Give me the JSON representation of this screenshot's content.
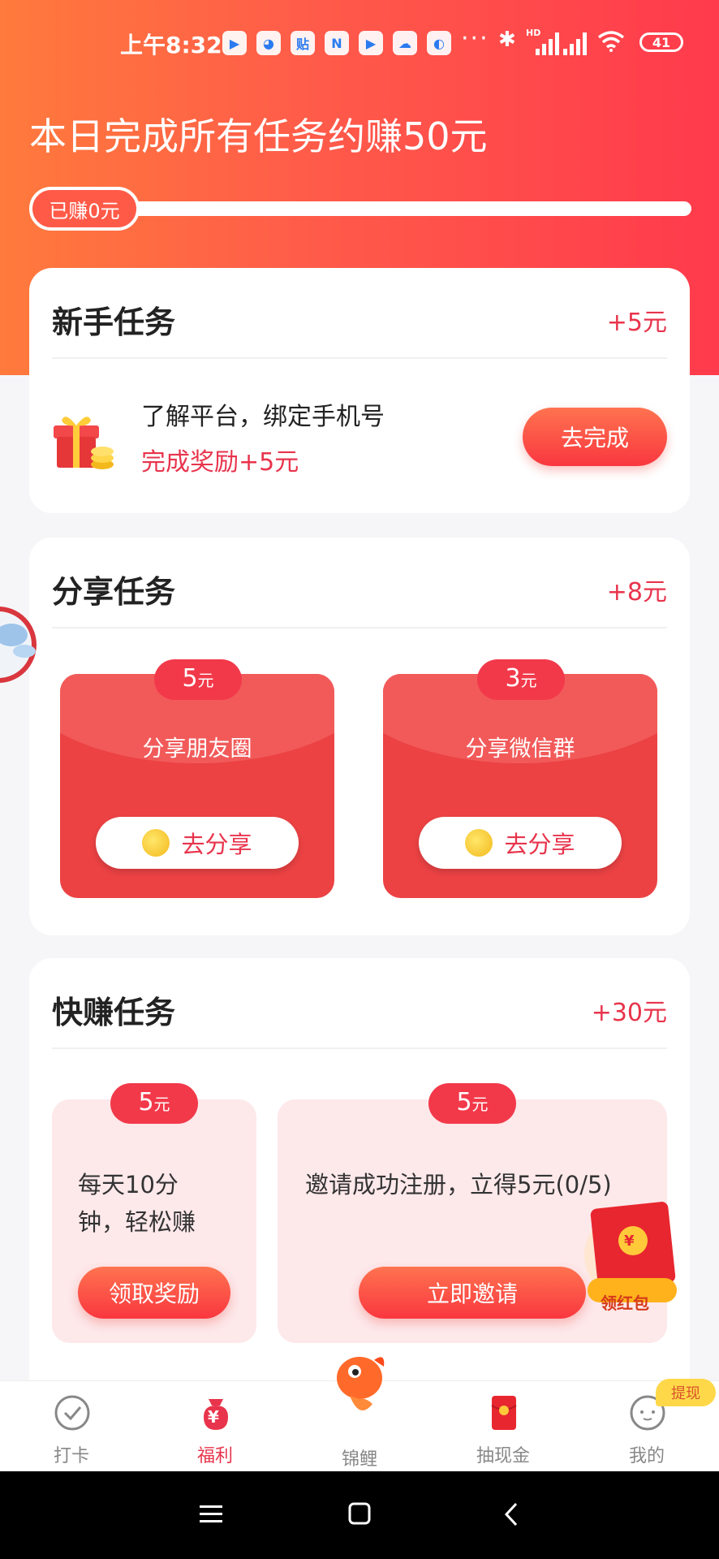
{
  "status_bar": {
    "time": "上午8:32",
    "app_icons": [
      "play-store-icon",
      "browser-icon",
      "notes-icon",
      "n-app-icon",
      "video-icon",
      "cloud-icon",
      "moon-icon"
    ],
    "app_icon_glyphs": [
      "▶",
      "◕",
      "贴",
      "N",
      "▶",
      "☁",
      "◐"
    ],
    "more": "···",
    "bluetooth": "✱",
    "hd": "HD",
    "battery": "41"
  },
  "header": {
    "title": "本日完成所有任务约赚50元",
    "earned": "已赚0元"
  },
  "newbie": {
    "title": "新手任务",
    "reward": "+5元",
    "task": "了解平台，绑定手机号",
    "bonus": "完成奖励+5元",
    "button": "去完成"
  },
  "share": {
    "title": "分享任务",
    "reward": "+8元",
    "cards": [
      {
        "amount": "5",
        "unit": "元",
        "label": "分享朋友圈",
        "button": "去分享"
      },
      {
        "amount": "3",
        "unit": "元",
        "label": "分享微信群",
        "button": "去分享"
      }
    ]
  },
  "quick": {
    "title": "快赚任务",
    "reward": "+30元",
    "cards": [
      {
        "amount": "5",
        "unit": "元",
        "line1": "每天10分",
        "line2": "钟，轻松赚",
        "button": "领取奖励"
      },
      {
        "amount": "5",
        "unit": "元",
        "text": "邀请成功注册，立得5元(0/5)",
        "button": "立即邀请"
      }
    ]
  },
  "floating": {
    "red_packet": "领红包",
    "red_packet_coin": "¥"
  },
  "nav": {
    "items": [
      {
        "label": "打卡",
        "icon": "checkin-icon"
      },
      {
        "label": "福利",
        "icon": "welfare-icon"
      },
      {
        "label": "锦鲤",
        "icon": "koi-icon"
      },
      {
        "label": "抽现金",
        "icon": "cash-draw-icon"
      },
      {
        "label": "我的",
        "icon": "profile-icon"
      }
    ],
    "active": "福利",
    "badge": "提现",
    "welfare_glyph": "¥"
  },
  "colors": {
    "accent": "#e8344c",
    "gradient_start": "#ff7a3c",
    "gradient_end": "#ff3a4c"
  }
}
